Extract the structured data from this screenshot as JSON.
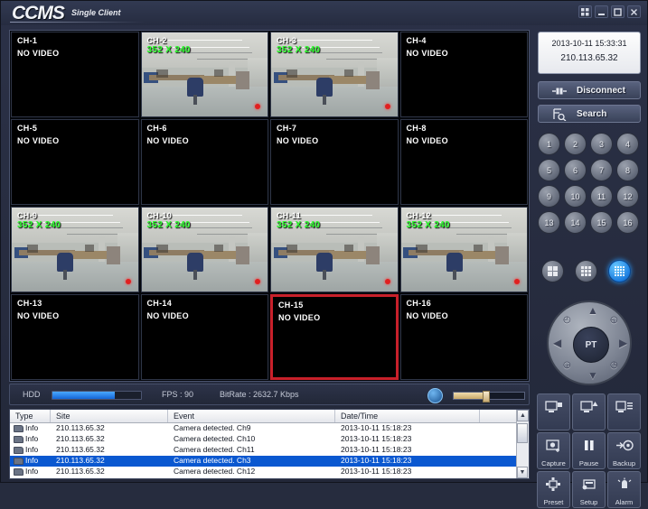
{
  "titlebar": {
    "logo": "CCMS",
    "subtitle": "Single Client",
    "buttons": [
      {
        "name": "fullscreen-button",
        "icon": "grid-icon"
      },
      {
        "name": "minimize-button",
        "icon": "minimize-icon"
      },
      {
        "name": "maximize-button",
        "icon": "maximize-icon"
      },
      {
        "name": "close-button",
        "icon": "close-icon"
      }
    ]
  },
  "grid": {
    "layout": "4x4",
    "selected_channel": "CH-15",
    "no_video_text": "NO VIDEO",
    "resolution_text": "352 X 240",
    "cells": [
      {
        "label": "CH-1",
        "live": false
      },
      {
        "label": "CH-2",
        "live": true
      },
      {
        "label": "CH-3",
        "live": true
      },
      {
        "label": "CH-4",
        "live": false
      },
      {
        "label": "CH-5",
        "live": false
      },
      {
        "label": "CH-6",
        "live": false
      },
      {
        "label": "CH-7",
        "live": false
      },
      {
        "label": "CH-8",
        "live": false
      },
      {
        "label": "CH-9",
        "live": true
      },
      {
        "label": "CH-10",
        "live": true
      },
      {
        "label": "CH-11",
        "live": true
      },
      {
        "label": "CH-12",
        "live": true
      },
      {
        "label": "CH-13",
        "live": false
      },
      {
        "label": "CH-14",
        "live": false
      },
      {
        "label": "CH-15",
        "live": false
      },
      {
        "label": "CH-16",
        "live": false
      }
    ]
  },
  "status": {
    "hdd_label": "HDD",
    "hdd_percent": 70,
    "fps": "FPS : 90",
    "bitrate": "BitRate : 2632.7 Kbps",
    "speaker_icon": "speaker-icon",
    "volume_percent": 45
  },
  "right_panel": {
    "datetime": "2013-10-11 15:33:31",
    "ip": "210.113.65.32",
    "disconnect_label": "Disconnect",
    "search_label": "Search",
    "channel_numbers": [
      "1",
      "2",
      "3",
      "4",
      "5",
      "6",
      "7",
      "8",
      "9",
      "10",
      "11",
      "12",
      "13",
      "14",
      "15",
      "16"
    ],
    "layouts": [
      {
        "name": "layout-2x2",
        "cols": 2,
        "active": false
      },
      {
        "name": "layout-3x3",
        "cols": 3,
        "active": false
      },
      {
        "name": "layout-4x4",
        "cols": 4,
        "active": true
      }
    ],
    "ptz_center": "PT",
    "functions": [
      {
        "name": "snapshot-button",
        "label": "",
        "icon": "monitor-record-icon"
      },
      {
        "name": "export-button",
        "label": "",
        "icon": "monitor-up-icon"
      },
      {
        "name": "list-button",
        "label": "",
        "icon": "monitor-list-icon"
      },
      {
        "name": "capture-button",
        "label": "Capture",
        "icon": "capture-icon"
      },
      {
        "name": "pause-button",
        "label": "Pause",
        "icon": "pause-icon"
      },
      {
        "name": "backup-button",
        "label": "Backup",
        "icon": "backup-icon"
      },
      {
        "name": "preset-button",
        "label": "Preset",
        "icon": "preset-icon"
      },
      {
        "name": "setup-button",
        "label": "Setup",
        "icon": "setup-icon"
      },
      {
        "name": "alarm-button",
        "label": "Alarm",
        "icon": "alarm-icon"
      }
    ]
  },
  "log": {
    "columns": [
      "Type",
      "Site",
      "Event",
      "Date/Time",
      ""
    ],
    "rows": [
      {
        "type": "Info",
        "site": "210.113.65.32",
        "event": "Camera detected. Ch9",
        "datetime": "2013-10-11 15:18:23",
        "selected": false
      },
      {
        "type": "Info",
        "site": "210.113.65.32",
        "event": "Camera detected. Ch10",
        "datetime": "2013-10-11 15:18:23",
        "selected": false
      },
      {
        "type": "Info",
        "site": "210.113.65.32",
        "event": "Camera detected. Ch11",
        "datetime": "2013-10-11 15:18:23",
        "selected": false
      },
      {
        "type": "Info",
        "site": "210.113.65.32",
        "event": "Camera detected. Ch3",
        "datetime": "2013-10-11 15:18:23",
        "selected": true
      },
      {
        "type": "Info",
        "site": "210.113.65.32",
        "event": "Camera detected. Ch12",
        "datetime": "2013-10-11 15:18:23",
        "selected": false
      }
    ],
    "scroll_up": "▲",
    "scroll_down": "▼"
  },
  "colors": {
    "accent_blue": "#1e7fe0",
    "selection_red": "#c8202a",
    "overlay_green": "#2bff2b",
    "panel_bg": "#262c3e",
    "row_selected": "#0a58d0"
  }
}
